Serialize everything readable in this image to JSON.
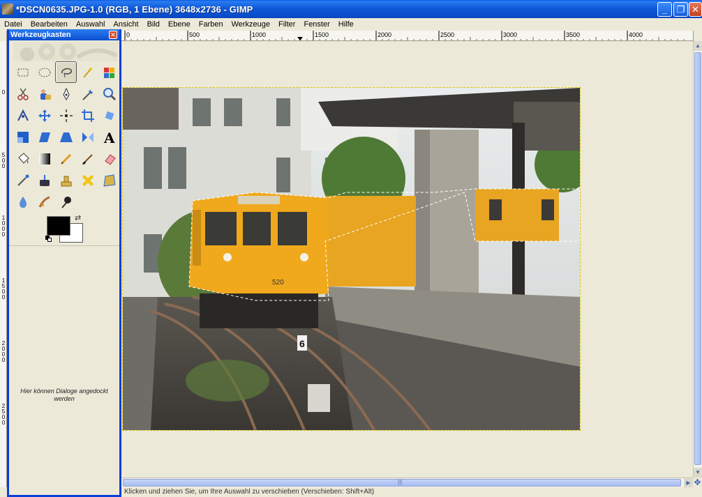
{
  "window": {
    "title": "*DSCN0635.JPG-1.0 (RGB, 1 Ebene) 3648x2736 - GIMP",
    "min_glyph": "_",
    "max_glyph": "❐",
    "close_glyph": "✕"
  },
  "menubar": {
    "items": [
      {
        "label": "Datei",
        "name": "datei"
      },
      {
        "label": "Bearbeiten",
        "name": "bearbeiten"
      },
      {
        "label": "Auswahl",
        "name": "auswahl"
      },
      {
        "label": "Ansicht",
        "name": "ansicht"
      },
      {
        "label": "Bild",
        "name": "bild"
      },
      {
        "label": "Ebene",
        "name": "ebene"
      },
      {
        "label": "Farben",
        "name": "farben"
      },
      {
        "label": "Werkzeuge",
        "name": "werkzeuge"
      },
      {
        "label": "Filter",
        "name": "filter"
      },
      {
        "label": "Fenster",
        "name": "fenster"
      },
      {
        "label": "Hilfe",
        "name": "hilfe"
      }
    ]
  },
  "ruler": {
    "top_labels": [
      "0",
      "500",
      "1000",
      "1500",
      "2000",
      "2500",
      "3000",
      "3500",
      "4000"
    ],
    "left_labels": [
      "0",
      "500",
      "1000",
      "1500",
      "2000",
      "2500"
    ]
  },
  "toolbox": {
    "title": "Werkzeugkasten",
    "close_glyph": "✕",
    "tools": [
      {
        "name": "rect-select",
        "active": false
      },
      {
        "name": "ellipse-select",
        "active": false
      },
      {
        "name": "free-select-lasso",
        "active": true
      },
      {
        "name": "fuzzy-select-wand",
        "active": false
      },
      {
        "name": "select-by-color",
        "active": false
      },
      {
        "name": "scissors-select",
        "active": false
      },
      {
        "name": "foreground-select",
        "active": false
      },
      {
        "name": "paths",
        "active": false
      },
      {
        "name": "color-picker",
        "active": false
      },
      {
        "name": "zoom",
        "active": false
      },
      {
        "name": "measure",
        "active": false
      },
      {
        "name": "move",
        "active": false
      },
      {
        "name": "align",
        "active": false
      },
      {
        "name": "crop",
        "active": false
      },
      {
        "name": "rotate",
        "active": false
      },
      {
        "name": "scale",
        "active": false
      },
      {
        "name": "shear",
        "active": false
      },
      {
        "name": "perspective",
        "active": false
      },
      {
        "name": "flip",
        "active": false
      },
      {
        "name": "text",
        "active": false
      },
      {
        "name": "bucket-fill",
        "active": false
      },
      {
        "name": "blend-gradient",
        "active": false
      },
      {
        "name": "pencil",
        "active": false
      },
      {
        "name": "paintbrush",
        "active": false
      },
      {
        "name": "eraser",
        "active": false
      },
      {
        "name": "airbrush",
        "active": false
      },
      {
        "name": "ink",
        "active": false
      },
      {
        "name": "clone-stamp",
        "active": false
      },
      {
        "name": "heal",
        "active": false
      },
      {
        "name": "perspective-clone",
        "active": false
      },
      {
        "name": "blur-sharpen",
        "active": false
      },
      {
        "name": "smudge",
        "active": false
      },
      {
        "name": "dodge-burn",
        "active": false
      }
    ],
    "colors": {
      "foreground": "#000000",
      "background": "#ffffff"
    },
    "swap_glyph": "⇄",
    "dock_hint": "Hier können Dialoge angedockt werden"
  },
  "statusbar": {
    "text": "Klicken und ziehen Sie, um Ihre Auswahl zu verschieben (Verschieben: Shift+Alt)"
  },
  "scroll": {
    "up_glyph": "▲",
    "down_glyph": "▼",
    "right_glyph": "▶",
    "grip_glyph": "|||",
    "nav_glyph": "✥"
  },
  "photo": {
    "train_number": "520",
    "track_sign": "6"
  }
}
